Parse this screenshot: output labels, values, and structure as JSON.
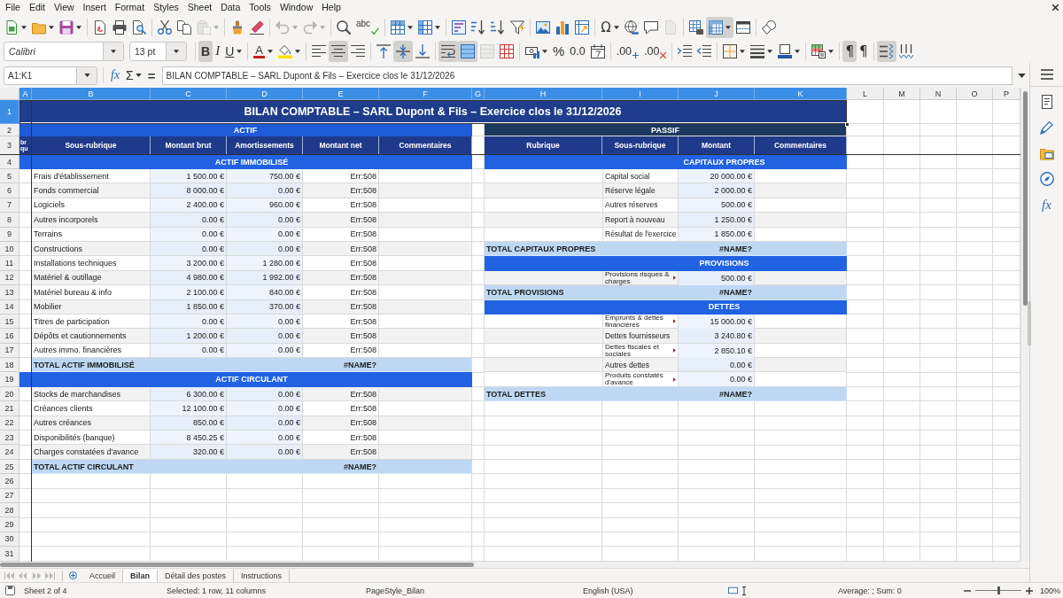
{
  "menu_bar": {
    "items": [
      "File",
      "Edit",
      "View",
      "Insert",
      "Format",
      "Styles",
      "Sheet",
      "Data",
      "Tools",
      "Window",
      "Help"
    ]
  },
  "standard_toolbar": {
    "paste": {
      "disabled": true
    },
    "undo": {
      "disabled": true
    },
    "redo": {
      "disabled": true
    },
    "spelling": {
      "glyph": "abc"
    },
    "special_character": {
      "glyph": "Ω"
    },
    "header_footer": {
      "disabled": true
    },
    "freeze_rows_columns": {
      "pressed": true
    }
  },
  "formatting_toolbar": {
    "font_name": "Calibri",
    "font_size": "13 pt",
    "bold": {
      "glyph": "B",
      "pressed": true
    },
    "italic": {
      "glyph": "I",
      "pressed": false
    },
    "underline": {
      "glyph": "U",
      "pressed": false
    },
    "font_color": {
      "glyph": "A"
    },
    "align_left": {
      "pressed": false
    },
    "align_center": {
      "pressed": true
    },
    "align_right": {
      "pressed": false
    },
    "align_top": {
      "pressed": false
    },
    "align_middle": {
      "pressed": true
    },
    "align_bottom": {
      "pressed": false
    },
    "wrap_text": {
      "pressed": true
    },
    "merge_and_center": {
      "pressed": true
    },
    "merge_cells": {
      "disabled": true
    },
    "percent": {
      "glyph": "%"
    },
    "standard_number": {
      "glyph": "0.0"
    },
    "add_decimal": {
      "glyph": ".00"
    },
    "delete_decimal": {
      "glyph": ".00"
    },
    "left_to_right": {
      "glyph": "¶",
      "pressed": true
    },
    "right_to_left": {
      "glyph": "¶",
      "pressed": false
    },
    "text_left_to_right": {
      "pressed": true
    },
    "text_top_to_bottom": {
      "pressed": false
    }
  },
  "formula_bar": {
    "name_box": "A1:K1",
    "function_wizard_glyph": "fx",
    "sum_glyph": "Σ",
    "formula_glyph": "=",
    "formula": "BILAN COMPTABLE – SARL Dupont & Fils – Exercice clos le 31/12/2026"
  },
  "sheet": {
    "column_headers": [
      {
        "label": "A",
        "selected": true
      },
      {
        "label": "B",
        "selected": true
      },
      {
        "label": "C",
        "selected": true
      },
      {
        "label": "D",
        "selected": true
      },
      {
        "label": "E",
        "selected": true
      },
      {
        "label": "F",
        "selected": true
      },
      {
        "label": "G",
        "selected": true
      },
      {
        "label": "H",
        "selected": true
      },
      {
        "label": "I",
        "selected": true
      },
      {
        "label": "J",
        "selected": true
      },
      {
        "label": "K",
        "selected": true
      },
      {
        "label": "L",
        "selected": false
      },
      {
        "label": "M",
        "selected": false
      },
      {
        "label": "N",
        "selected": false
      },
      {
        "label": "O",
        "selected": false
      },
      {
        "label": "P",
        "selected": false
      }
    ],
    "row_headers": [
      {
        "label": "1",
        "selected": true
      },
      {
        "label": "2",
        "selected": false
      },
      {
        "label": "3",
        "selected": false
      },
      {
        "label": "4",
        "selected": false
      },
      {
        "label": "5",
        "selected": false
      },
      {
        "label": "6",
        "selected": false
      },
      {
        "label": "7",
        "selected": false
      },
      {
        "label": "8",
        "selected": false
      },
      {
        "label": "9",
        "selected": false
      },
      {
        "label": "10",
        "selected": false
      },
      {
        "label": "11",
        "selected": false
      },
      {
        "label": "12",
        "selected": false
      },
      {
        "label": "13",
        "selected": false
      },
      {
        "label": "14",
        "selected": false
      },
      {
        "label": "15",
        "selected": false
      },
      {
        "label": "16",
        "selected": false
      },
      {
        "label": "17",
        "selected": false
      },
      {
        "label": "18",
        "selected": false
      },
      {
        "label": "19",
        "selected": false
      },
      {
        "label": "20",
        "selected": false
      },
      {
        "label": "21",
        "selected": false
      },
      {
        "label": "22",
        "selected": false
      },
      {
        "label": "23",
        "selected": false
      },
      {
        "label": "24",
        "selected": false
      },
      {
        "label": "25",
        "selected": false
      },
      {
        "label": "26",
        "selected": false
      },
      {
        "label": "27",
        "selected": false
      },
      {
        "label": "28",
        "selected": false
      },
      {
        "label": "29",
        "selected": false
      },
      {
        "label": "30",
        "selected": false
      },
      {
        "label": "31",
        "selected": false
      }
    ],
    "title": "BILAN COMPTABLE – SARL Dupont & Fils – Exercice clos le 31/12/2026",
    "actif": {
      "heading": "ACTIF",
      "side_heading": "br qu",
      "columns": [
        "Sous-rubrique",
        "Montant brut",
        "Amortissements",
        "Montant net",
        "Commentaires"
      ],
      "sections": [
        {
          "heading": "ACTIF IMMOBILISÉ",
          "rows": [
            {
              "label": "Frais d'établissement",
              "gross": "1 500.00 €",
              "depreciation": "750.00 €",
              "net": "Err:508"
            },
            {
              "label": "Fonds commercial",
              "gross": "8 000.00 €",
              "depreciation": "0.00 €",
              "net": "Err:508"
            },
            {
              "label": "Logiciels",
              "gross": "2 400.00 €",
              "depreciation": "960.00 €",
              "net": "Err:508"
            },
            {
              "label": "Autres incorporels",
              "gross": "0.00 €",
              "depreciation": "0.00 €",
              "net": "Err:508"
            },
            {
              "label": "Terrains",
              "gross": "0.00 €",
              "depreciation": "0.00 €",
              "net": "Err:508"
            },
            {
              "label": "Constructions",
              "gross": "0.00 €",
              "depreciation": "0.00 €",
              "net": "Err:508"
            },
            {
              "label": "Installations techniques",
              "gross": "3 200.00 €",
              "depreciation": "1 280.00 €",
              "net": "Err:508"
            },
            {
              "label": "Matériel & outillage",
              "gross": "4 980.00 €",
              "depreciation": "1 992.00 €",
              "net": "Err:508"
            },
            {
              "label": "Matériel bureau & info",
              "gross": "2 100.00 €",
              "depreciation": "840.00 €",
              "net": "Err:508"
            },
            {
              "label": "Mobilier",
              "gross": "1 850.00 €",
              "depreciation": "370.00 €",
              "net": "Err:508"
            },
            {
              "label": "Titres de participation",
              "gross": "0.00 €",
              "depreciation": "0.00 €",
              "net": "Err:508"
            },
            {
              "label": "Dépôts et cautionnements",
              "gross": "1 200.00 €",
              "depreciation": "0.00 €",
              "net": "Err:508"
            },
            {
              "label": "Autres immo. financières",
              "gross": "0.00 €",
              "depreciation": "0.00 €",
              "net": "Err:508"
            }
          ],
          "total": {
            "label": "TOTAL ACTIF IMMOBILISÉ",
            "value": "#NAME?"
          }
        },
        {
          "heading": "ACTIF CIRCULANT",
          "rows": [
            {
              "label": "Stocks de marchandises",
              "gross": "6 300.00 €",
              "depreciation": "0.00 €",
              "net": "Err:508"
            },
            {
              "label": "Créances clients",
              "gross": "12 100.00 €",
              "depreciation": "0.00 €",
              "net": "Err:508"
            },
            {
              "label": "Autres créances",
              "gross": "850.00 €",
              "depreciation": "0.00 €",
              "net": "Err:508"
            },
            {
              "label": "Disponibilités (banque)",
              "gross": "8 450.25 €",
              "depreciation": "0.00 €",
              "net": "Err:508"
            },
            {
              "label": "Charges constatées d'avance",
              "gross": "320.00 €",
              "depreciation": "0.00 €",
              "net": "Err:508"
            }
          ],
          "total": {
            "label": "TOTAL ACTIF CIRCULANT",
            "value": "#NAME?"
          }
        }
      ]
    },
    "passif": {
      "heading": "PASSIF",
      "columns": [
        "Rubrique",
        "Sous-rubrique",
        "Montant",
        "Commentaires"
      ],
      "sections": [
        {
          "heading": "CAPITAUX PROPRES",
          "rows": [
            {
              "label": "Capital social",
              "amount": "20 000.00 €",
              "overflow": false
            },
            {
              "label": "Réserve légale",
              "amount": "2 000.00 €",
              "overflow": false
            },
            {
              "label": "Autres réserves",
              "amount": "500.00 €",
              "overflow": false
            },
            {
              "label": "Report à nouveau",
              "amount": "1 250.00 €",
              "overflow": false
            },
            {
              "label": "Résultat de l'exercice",
              "amount": "1 850.00 €",
              "overflow": false
            }
          ],
          "total": {
            "label": "TOTAL CAPITAUX PROPRES",
            "value": "#NAME?"
          }
        },
        {
          "heading": "PROVISIONS",
          "rows": [
            {
              "label": "Provisions risques & charges",
              "amount": "500.00 €",
              "overflow": true
            }
          ],
          "total": {
            "label": "TOTAL PROVISIONS",
            "value": "#NAME?"
          }
        },
        {
          "heading": "DETTES",
          "rows": [
            {
              "label": "Emprunts & dettes financières",
              "amount": "15 000.00 €",
              "overflow": true
            },
            {
              "label": "Dettes fournisseurs",
              "amount": "3 240.80 €",
              "overflow": false
            },
            {
              "label": "Dettes fiscales et sociales",
              "amount": "2 850.10 €",
              "overflow": true
            },
            {
              "label": "Autres dettes",
              "amount": "0.00 €",
              "overflow": false
            },
            {
              "label": "Produits constatés d'avance",
              "amount": "0.00 €",
              "overflow": true
            }
          ],
          "total": {
            "label": "TOTAL DETTES",
            "value": "#NAME?"
          }
        }
      ]
    }
  },
  "sheet_tabs": [
    {
      "label": "Accueil",
      "selected": false
    },
    {
      "label": "Bilan",
      "selected": true
    },
    {
      "label": "Détail des postes",
      "selected": false
    },
    {
      "label": "Instructions",
      "selected": false
    }
  ],
  "sidebar": {
    "functions_glyph": "fx"
  },
  "status_bar": {
    "sheet_position": "Sheet 2 of 4",
    "selection": "Selected: 1 row, 11 columns",
    "page_style": "PageStyle_Bilan",
    "language": "English (USA)",
    "summary": "Average: ; Sum: 0",
    "zoom_slider": {
      "level": 0.5
    },
    "zoom": "100%"
  }
}
